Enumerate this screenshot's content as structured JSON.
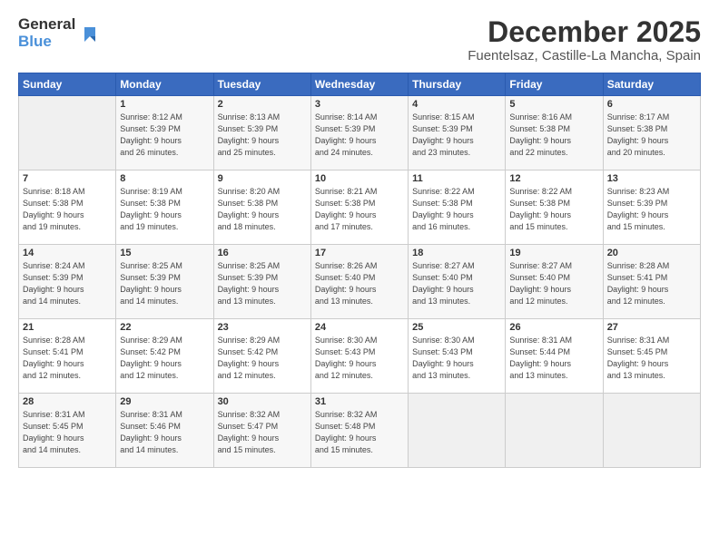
{
  "header": {
    "logo_general": "General",
    "logo_blue": "Blue",
    "title": "December 2025",
    "location": "Fuentelsaz, Castille-La Mancha, Spain"
  },
  "days_of_week": [
    "Sunday",
    "Monday",
    "Tuesday",
    "Wednesday",
    "Thursday",
    "Friday",
    "Saturday"
  ],
  "weeks": [
    [
      {
        "day": "",
        "info": ""
      },
      {
        "day": "1",
        "info": "Sunrise: 8:12 AM\nSunset: 5:39 PM\nDaylight: 9 hours\nand 26 minutes."
      },
      {
        "day": "2",
        "info": "Sunrise: 8:13 AM\nSunset: 5:39 PM\nDaylight: 9 hours\nand 25 minutes."
      },
      {
        "day": "3",
        "info": "Sunrise: 8:14 AM\nSunset: 5:39 PM\nDaylight: 9 hours\nand 24 minutes."
      },
      {
        "day": "4",
        "info": "Sunrise: 8:15 AM\nSunset: 5:39 PM\nDaylight: 9 hours\nand 23 minutes."
      },
      {
        "day": "5",
        "info": "Sunrise: 8:16 AM\nSunset: 5:38 PM\nDaylight: 9 hours\nand 22 minutes."
      },
      {
        "day": "6",
        "info": "Sunrise: 8:17 AM\nSunset: 5:38 PM\nDaylight: 9 hours\nand 20 minutes."
      }
    ],
    [
      {
        "day": "7",
        "info": "Sunrise: 8:18 AM\nSunset: 5:38 PM\nDaylight: 9 hours\nand 19 minutes."
      },
      {
        "day": "8",
        "info": "Sunrise: 8:19 AM\nSunset: 5:38 PM\nDaylight: 9 hours\nand 19 minutes."
      },
      {
        "day": "9",
        "info": "Sunrise: 8:20 AM\nSunset: 5:38 PM\nDaylight: 9 hours\nand 18 minutes."
      },
      {
        "day": "10",
        "info": "Sunrise: 8:21 AM\nSunset: 5:38 PM\nDaylight: 9 hours\nand 17 minutes."
      },
      {
        "day": "11",
        "info": "Sunrise: 8:22 AM\nSunset: 5:38 PM\nDaylight: 9 hours\nand 16 minutes."
      },
      {
        "day": "12",
        "info": "Sunrise: 8:22 AM\nSunset: 5:38 PM\nDaylight: 9 hours\nand 15 minutes."
      },
      {
        "day": "13",
        "info": "Sunrise: 8:23 AM\nSunset: 5:39 PM\nDaylight: 9 hours\nand 15 minutes."
      }
    ],
    [
      {
        "day": "14",
        "info": "Sunrise: 8:24 AM\nSunset: 5:39 PM\nDaylight: 9 hours\nand 14 minutes."
      },
      {
        "day": "15",
        "info": "Sunrise: 8:25 AM\nSunset: 5:39 PM\nDaylight: 9 hours\nand 14 minutes."
      },
      {
        "day": "16",
        "info": "Sunrise: 8:25 AM\nSunset: 5:39 PM\nDaylight: 9 hours\nand 13 minutes."
      },
      {
        "day": "17",
        "info": "Sunrise: 8:26 AM\nSunset: 5:40 PM\nDaylight: 9 hours\nand 13 minutes."
      },
      {
        "day": "18",
        "info": "Sunrise: 8:27 AM\nSunset: 5:40 PM\nDaylight: 9 hours\nand 13 minutes."
      },
      {
        "day": "19",
        "info": "Sunrise: 8:27 AM\nSunset: 5:40 PM\nDaylight: 9 hours\nand 12 minutes."
      },
      {
        "day": "20",
        "info": "Sunrise: 8:28 AM\nSunset: 5:41 PM\nDaylight: 9 hours\nand 12 minutes."
      }
    ],
    [
      {
        "day": "21",
        "info": "Sunrise: 8:28 AM\nSunset: 5:41 PM\nDaylight: 9 hours\nand 12 minutes."
      },
      {
        "day": "22",
        "info": "Sunrise: 8:29 AM\nSunset: 5:42 PM\nDaylight: 9 hours\nand 12 minutes."
      },
      {
        "day": "23",
        "info": "Sunrise: 8:29 AM\nSunset: 5:42 PM\nDaylight: 9 hours\nand 12 minutes."
      },
      {
        "day": "24",
        "info": "Sunrise: 8:30 AM\nSunset: 5:43 PM\nDaylight: 9 hours\nand 12 minutes."
      },
      {
        "day": "25",
        "info": "Sunrise: 8:30 AM\nSunset: 5:43 PM\nDaylight: 9 hours\nand 13 minutes."
      },
      {
        "day": "26",
        "info": "Sunrise: 8:31 AM\nSunset: 5:44 PM\nDaylight: 9 hours\nand 13 minutes."
      },
      {
        "day": "27",
        "info": "Sunrise: 8:31 AM\nSunset: 5:45 PM\nDaylight: 9 hours\nand 13 minutes."
      }
    ],
    [
      {
        "day": "28",
        "info": "Sunrise: 8:31 AM\nSunset: 5:45 PM\nDaylight: 9 hours\nand 14 minutes."
      },
      {
        "day": "29",
        "info": "Sunrise: 8:31 AM\nSunset: 5:46 PM\nDaylight: 9 hours\nand 14 minutes."
      },
      {
        "day": "30",
        "info": "Sunrise: 8:32 AM\nSunset: 5:47 PM\nDaylight: 9 hours\nand 15 minutes."
      },
      {
        "day": "31",
        "info": "Sunrise: 8:32 AM\nSunset: 5:48 PM\nDaylight: 9 hours\nand 15 minutes."
      },
      {
        "day": "",
        "info": ""
      },
      {
        "day": "",
        "info": ""
      },
      {
        "day": "",
        "info": ""
      }
    ]
  ]
}
